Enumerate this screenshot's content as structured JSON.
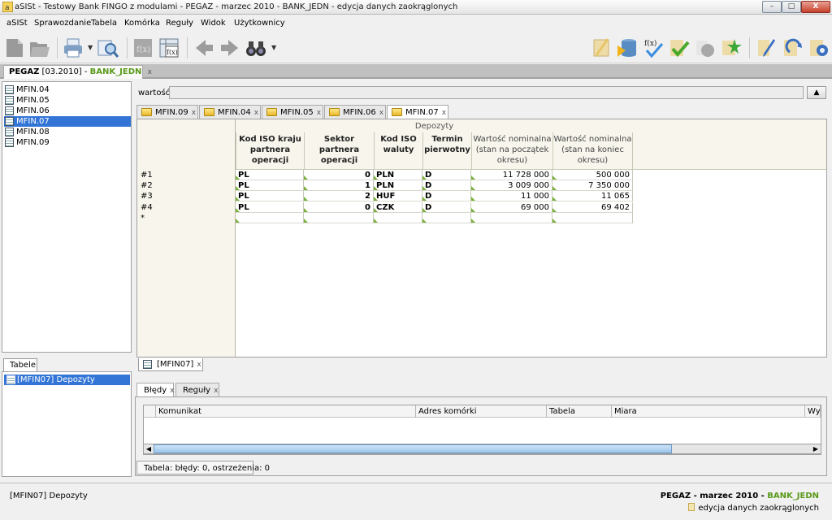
{
  "window": {
    "title": "aSISt - Testowy Bank FINGO z modulami - PEGAZ - marzec 2010 - BANK_JEDN - edycja danych zaokrąglonych",
    "min": "–",
    "max": "□",
    "close": "X"
  },
  "menu": [
    "aSISt",
    "Sprawozdanie",
    "Tabela",
    "Komórka",
    "Reguły",
    "Widok",
    "Użytkownicy"
  ],
  "doc_tab": {
    "name": "PEGAZ",
    "period": "[03.2010]",
    "sep": " - ",
    "unit": "BANK_JEDN",
    "close": "x"
  },
  "tree": [
    "MFIN.04",
    "MFIN.05",
    "MFIN.06",
    "MFIN.07",
    "MFIN.08",
    "MFIN.09"
  ],
  "tree_selected": "MFIN.07",
  "left_bottom": {
    "tab": "Tabele",
    "item": "[MFIN07] Depozyty"
  },
  "value_bar": {
    "label": "wartość:",
    "value": "",
    "btn": "▲"
  },
  "sheet_tabs": [
    {
      "label": "MFIN.09",
      "close": "x"
    },
    {
      "label": "MFIN.04",
      "close": "x"
    },
    {
      "label": "MFIN.05",
      "close": "x"
    },
    {
      "label": "MFIN.06",
      "close": "x"
    },
    {
      "label": "MFIN.07",
      "close": "x"
    }
  ],
  "grid": {
    "group_header": "Depozyty",
    "columns": [
      {
        "l1": "Kod ISO kraju",
        "l2": "partnera operacji",
        "l3": ""
      },
      {
        "l1": "Sektor partnera",
        "l2": "operacji",
        "l3": ""
      },
      {
        "l1": "Kod ISO",
        "l2": "waluty",
        "l3": ""
      },
      {
        "l1": "Termin",
        "l2": "pierwotny",
        "l3": ""
      },
      {
        "l1": "Wartość nominalna",
        "l2": "(stan na początek",
        "l3": "okresu)"
      },
      {
        "l1": "Wartość nominalna",
        "l2": "(stan na koniec",
        "l3": "okresu)"
      }
    ],
    "rows": [
      {
        "id": "#1",
        "cells": [
          "PL",
          "0",
          "PLN",
          "D",
          "11 728 000",
          "500 000"
        ]
      },
      {
        "id": "#2",
        "cells": [
          "PL",
          "1",
          "PLN",
          "D",
          "3 009 000",
          "7 350 000"
        ]
      },
      {
        "id": "#3",
        "cells": [
          "PL",
          "2",
          "HUF",
          "D",
          "11 000",
          "11 065"
        ]
      },
      {
        "id": "#4",
        "cells": [
          "PL",
          "0",
          "CZK",
          "D",
          "69 000",
          "69 402"
        ]
      }
    ],
    "new_row": "*"
  },
  "grid_bottom_tab": {
    "label": "[MFIN07]",
    "close": "x"
  },
  "bottom_tabs": [
    {
      "label": "Błędy",
      "close": "x"
    },
    {
      "label": "Reguły",
      "close": "x"
    }
  ],
  "messages": {
    "columns": [
      "Komunikat",
      "Adres komórki",
      "Tabela",
      "Miara",
      "Wyr"
    ]
  },
  "status_table": "Tabela: błędy: 0, ostrzeżenia: 0",
  "status": {
    "left": "[MFIN07] Depozyty",
    "right_name": "PEGAZ - marzec 2010 - ",
    "right_unit": "BANK_JEDN",
    "right_mode": "edycja danych zaokrąglonych"
  },
  "colors": {
    "accent_green": "#5a9a1a",
    "selection": "#3375d6"
  },
  "toolbar_icons": [
    "new-icon",
    "open-icon",
    "print-icon",
    "preview-icon",
    "formula-icon",
    "fx-icon",
    "back-icon",
    "forward-icon",
    "binoculars-icon",
    "note-icon",
    "db-export-icon",
    "fx-check-icon",
    "check-icon",
    "shapes-icon",
    "star-icon",
    "pen-icon",
    "refresh-icon",
    "settings-icon"
  ]
}
